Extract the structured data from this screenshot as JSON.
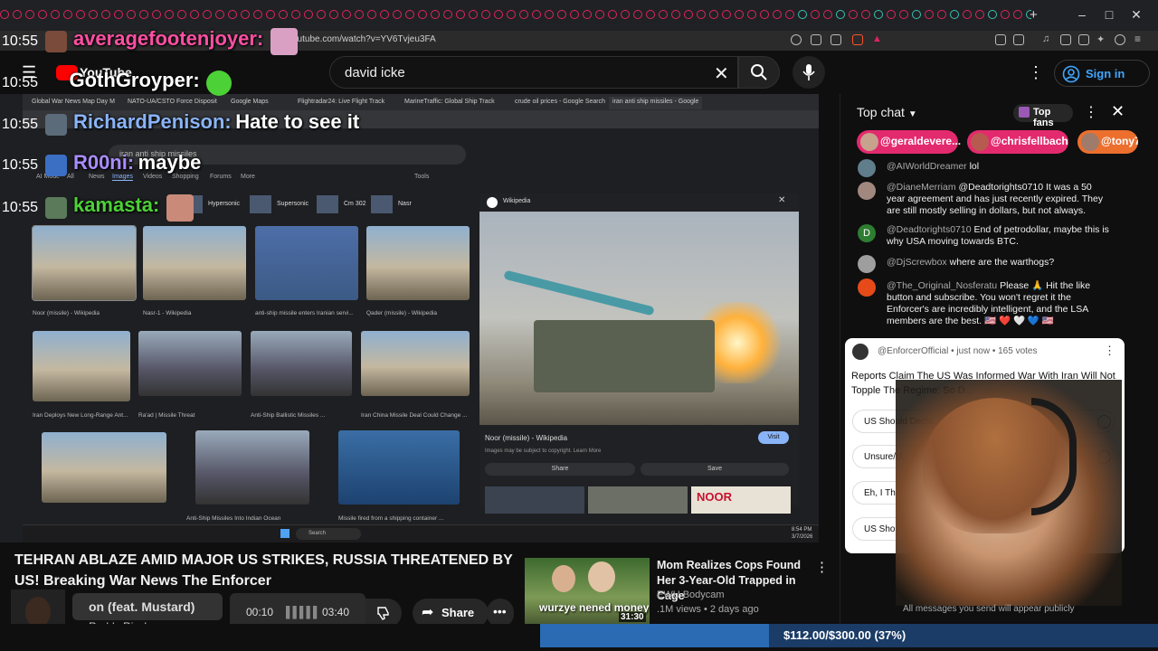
{
  "browser": {
    "url": "youtube.com/watch?v=YV6Tvjeu3FA",
    "window_controls": [
      "–",
      "□",
      "✕"
    ],
    "new_tab": "+"
  },
  "youtube": {
    "logo_text": "YouTube",
    "search_value": "david icke",
    "sign_in": "Sign in"
  },
  "overlay_chat": [
    {
      "time": "10:55",
      "name": "averagefootenjoyer:",
      "msg": ""
    },
    {
      "time": "10:55",
      "name": "GothGroyper:",
      "msg": ""
    },
    {
      "time": "10:55",
      "name": "RichardPenison:",
      "msg": "Hate to see it"
    },
    {
      "time": "10:55",
      "name": "R00ni:",
      "msg": "maybe"
    },
    {
      "time": "10:55",
      "name": "kamasta:",
      "msg": ""
    }
  ],
  "video_content": {
    "tabs": [
      "Global War News Map Day M",
      "NATO-UA/CSTO Force Disposit",
      "Google Maps",
      "Flightradar24: Live Flight Track",
      "MarineTraffic: Global Ship Track",
      "crude oil prices - Google Search",
      "iran anti ship missiles - Google"
    ],
    "google_query": "iran anti ship missiles",
    "google_tabs": [
      "AI Mode",
      "All",
      "News",
      "Images",
      "Videos",
      "Shopping",
      "Forums",
      "More",
      "Tools"
    ],
    "chips": [
      "Hypersonic",
      "Supersonic",
      "Cm 302",
      "Nasr"
    ],
    "thumb_captions": [
      "Noor (missile) - Wikipedia",
      "Nasr-1 - Wikipedia",
      "anti-ship missile enters Iranian servi...",
      "Qader (missile) - Wikipedia",
      "Iran Deploys New Long-Range Ant...",
      "Ra'ad | Missile Threat",
      "Anti-Ship Ballistic Missiles ...",
      "Iran China Missile Deal Could Change ...",
      "",
      "Anti-Ship Missiles Into Indian Ocean",
      "Missile fired from a shipping container ..."
    ],
    "preview_source": "Wikipedia",
    "preview_title": "Noor (missile) - Wikipedia",
    "preview_note": "Images may be subject to copyright. Learn More",
    "visit": "Visit",
    "share": "Share",
    "save": "Save",
    "noor_label": "NOOR",
    "taskbar_search": "Search",
    "clock": "8:54 PM",
    "date": "3/7/2026"
  },
  "video": {
    "title": "TEHRAN ABLAZE AMID MAJOR US STRIKES, RUSSIA THREATENED BY US! Breaking War News The Enforcer",
    "share_label": "Share"
  },
  "music": {
    "song": "on (feat. Mustard)",
    "artist": "Roddy Ricch",
    "elapsed": "00:10",
    "duration": "03:40"
  },
  "recommended": {
    "title": "Mom Realizes Cops Found Her 3-Year-Old Trapped in Cage",
    "channel": "EWU Bodycam",
    "meta": ".1M views • 2 days ago",
    "duration": "31:30",
    "overlay_caption": "wurzye nened money"
  },
  "live_chat": {
    "header": "Top chat",
    "top_fans": "Top fans",
    "pinned": [
      "@geraldevere...",
      "@chrisfellbach",
      "@tony7("
    ],
    "messages": [
      {
        "user": "@AIWorldDreamer",
        "text": "lol",
        "color": "#607d8b"
      },
      {
        "user": "@DianeMerriam",
        "text": "@Deadtorights0710 It was a 50 year agreement and has just recently expired. They are still mostly selling in dollars, but not always.",
        "color": "#a1887f"
      },
      {
        "user": "@Deadtorights0710",
        "text": "End of petrodollar, maybe this is why USA moving towards BTC.",
        "color": "#2e7d32"
      },
      {
        "user": "@DjScrewbox",
        "text": "where are the warthogs?",
        "color": "#9e9e9e"
      },
      {
        "user": "@The_Original_Nosferatu",
        "text": "Please 🙏 Hit the like button and subscribe. You won't regret it the Enforcer's are incredibly intelligent, and the LSA members are the best. 🇺🇸 ❤️ 🤍 💙 🇺🇸",
        "color": "#e64a19"
      }
    ],
    "avatar_letter": "D",
    "poll": {
      "author": "@EnforcerOfficial • just now • 165 votes",
      "question": "Reports Claim The US Was Informed War With Iran Will Not Topple The Regime: So D...",
      "options": [
        "US Should Decla...",
        "Unsure/U...",
        "Eh, I Think I...",
        "US Sho..."
      ]
    },
    "footer": "All messages you send will appear publicly"
  },
  "goal": {
    "text": "$112.00/$300.00 (37%)",
    "progress": 0.37
  }
}
